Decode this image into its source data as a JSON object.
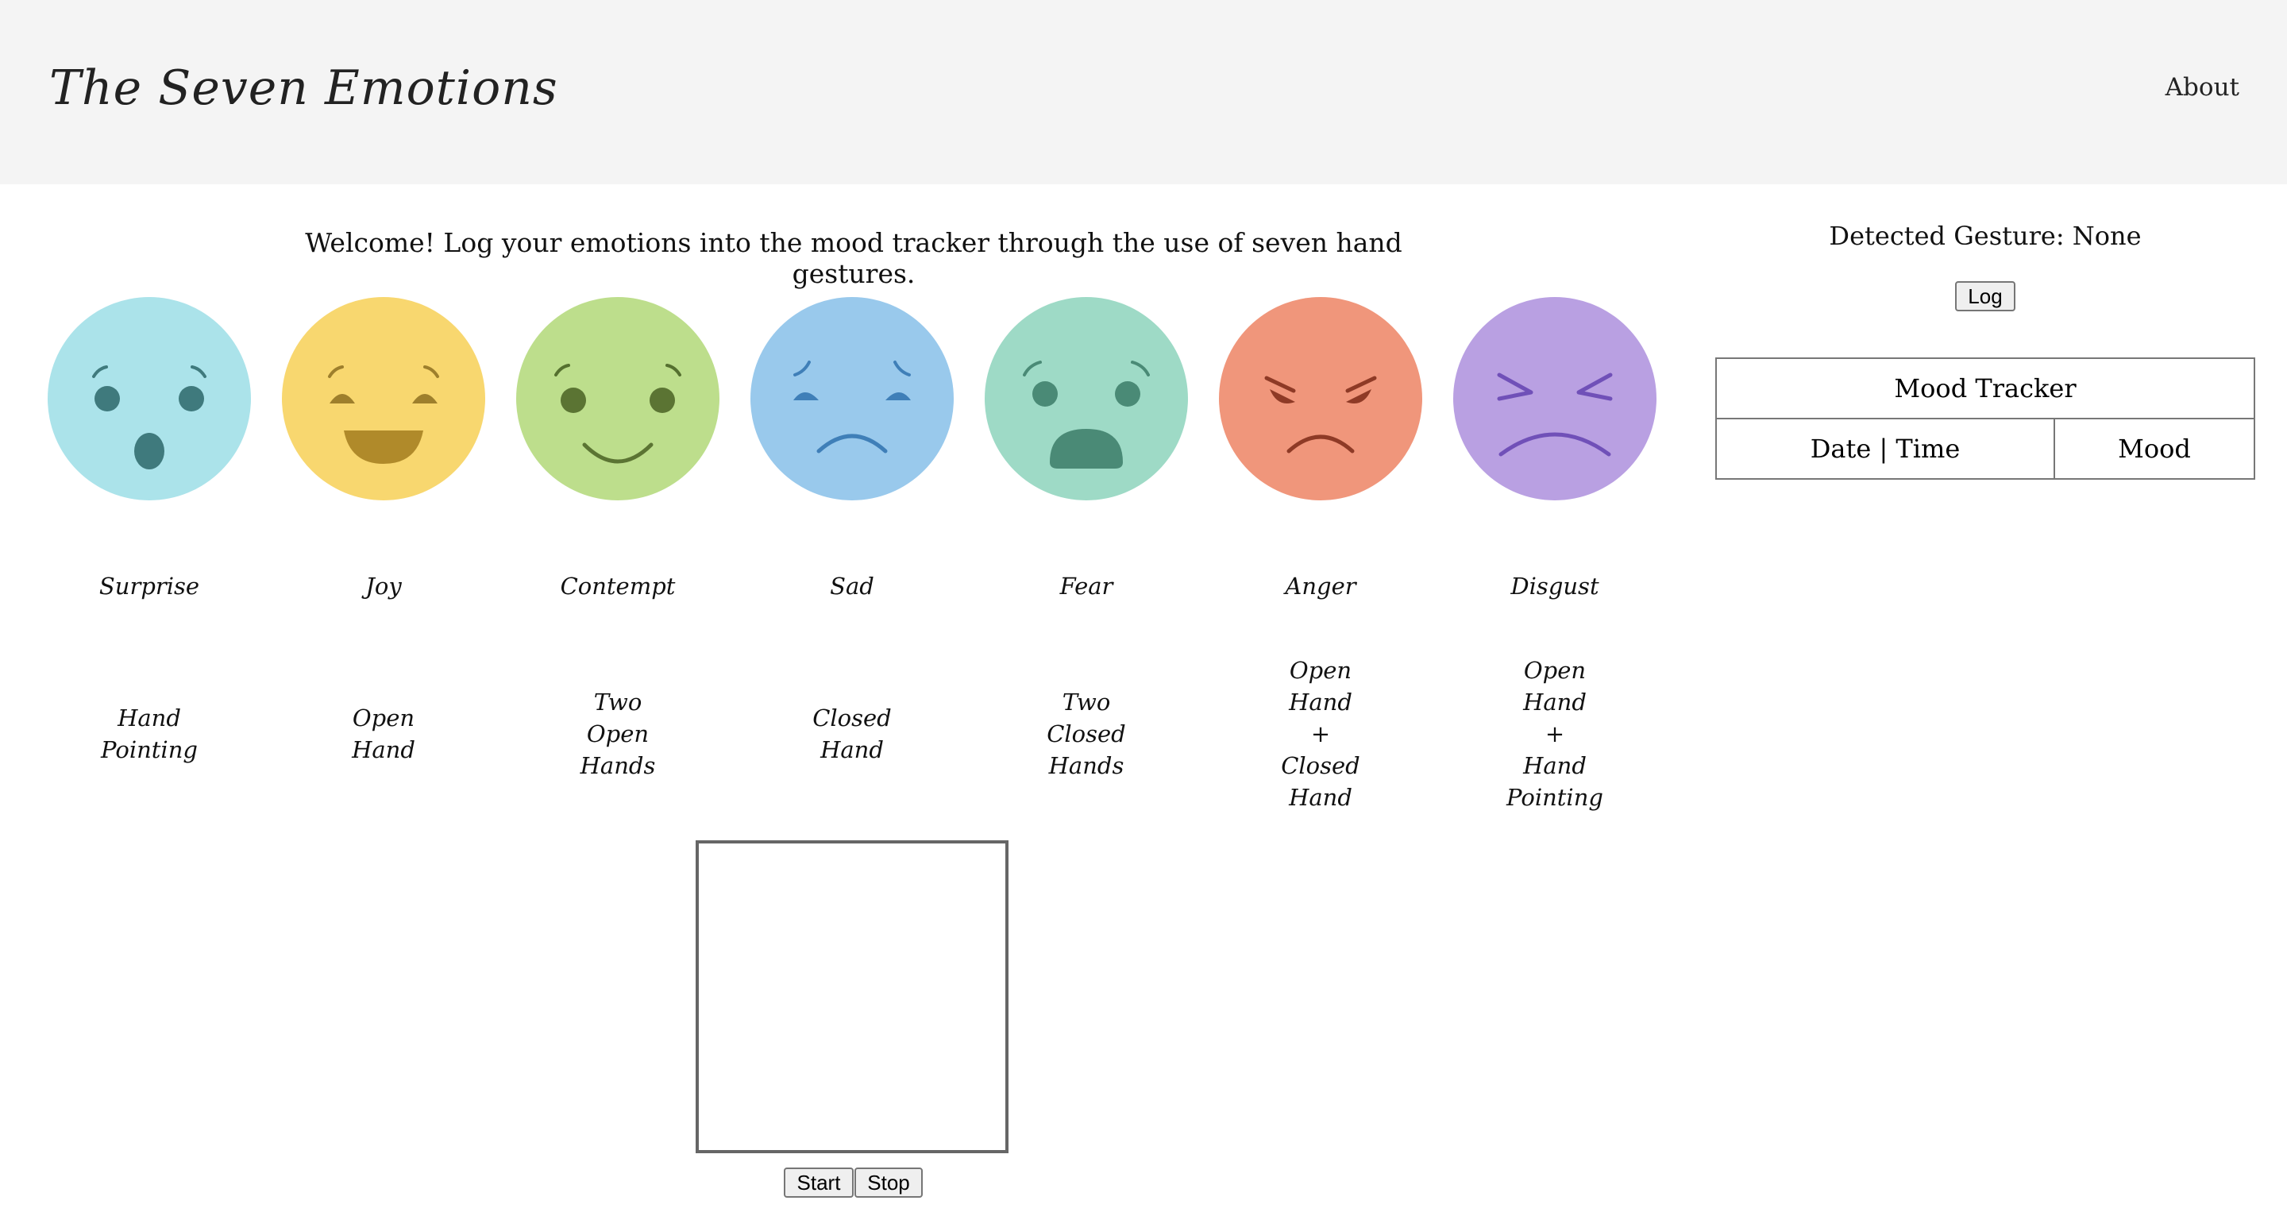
{
  "header": {
    "title": "The Seven Emotions",
    "about_label": "About"
  },
  "welcome_text": "Welcome! Log your emotions into the mood tracker through the use of seven hand gestures.",
  "emotions": [
    {
      "name": "Surprise",
      "gesture_lines": [
        "Hand",
        "Pointing"
      ],
      "color": "#abe3ea"
    },
    {
      "name": "Joy",
      "gesture_lines": [
        "Open",
        "Hand"
      ],
      "color": "#f8d76f"
    },
    {
      "name": "Contempt",
      "gesture_lines": [
        "Two",
        "Open",
        "Hands"
      ],
      "color": "#bdde8c"
    },
    {
      "name": "Sad",
      "gesture_lines": [
        "Closed",
        "Hand"
      ],
      "color": "#99c9ec"
    },
    {
      "name": "Fear",
      "gesture_lines": [
        "Two",
        "Closed",
        "Hands"
      ],
      "color": "#9edac6"
    },
    {
      "name": "Anger",
      "gesture_lines": [
        "Open",
        "Hand",
        "+",
        "Closed",
        "Hand"
      ],
      "color": "#f0967b"
    },
    {
      "name": "Disgust",
      "gesture_lines": [
        "Open",
        "Hand",
        "+",
        "Hand",
        "Pointing"
      ],
      "color": "#b9a0e2"
    }
  ],
  "camera": {
    "start_label": "Start",
    "stop_label": "Stop"
  },
  "side": {
    "detected_label": "Detected Gesture: None",
    "log_label": "Log",
    "table": {
      "title": "Mood Tracker",
      "col_datetime": "Date | Time",
      "col_mood": "Mood"
    }
  }
}
